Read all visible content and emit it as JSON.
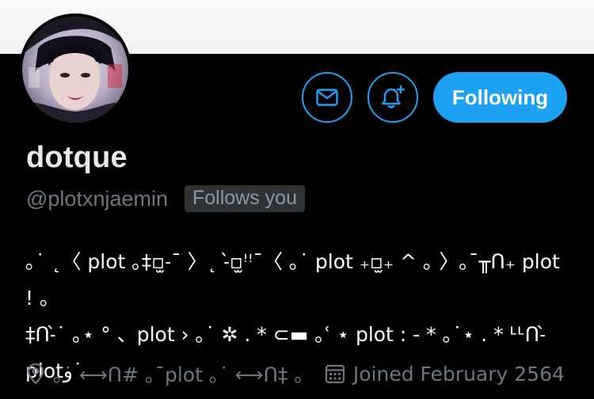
{
  "profile": {
    "display_name": "dotque",
    "handle": "@plotxnjaemin",
    "follows_you_badge": "Follows you",
    "bio": "｡˙ ˛〈 plot ｡‡▫̫˗¯ 〉˛ ˗̀▫̫ꜝꜝ¯〈 ｡˙ plot ₊▫̫₊ ^ ｡ 〉｡¯╥ᑎ₊ plot ! ｡\n‡ᑎ˗̀˙ ｡⋆ ° 、plot › ｡˙ ✲ . * ⊂▬ ｡ʿ ⋆ plot : - * ｡˙⋆ . * ᒻᒻᑎ˗̀\nplotﻭ˙",
    "location": "｡˙ ⟷ᑎ# ｡¯plot ｡˙ ⟷ᑎ‡ ｡",
    "joined": "Joined February 2564"
  },
  "actions": {
    "message_icon": "envelope-icon",
    "notify_icon": "bell-plus-icon",
    "following_label": "Following"
  },
  "colors": {
    "accent": "#1da1f2",
    "background": "#000000",
    "secondary_text": "#6e767d",
    "badge_bg": "#2f3336"
  }
}
